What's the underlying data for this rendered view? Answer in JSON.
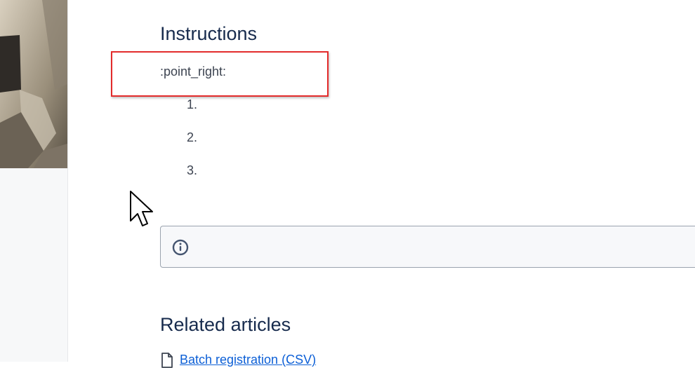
{
  "instructions": {
    "heading": "Instructions",
    "emoji_shortcode": ":point_right:",
    "steps": [
      "1.",
      "2.",
      "3."
    ]
  },
  "info_panel": {
    "icon": "info-icon"
  },
  "related": {
    "heading": "Related articles",
    "links": [
      {
        "label": "Batch registration (CSV)",
        "icon": "document-icon"
      }
    ]
  },
  "colors": {
    "heading": "#172b4d",
    "link": "#0c5fd6",
    "highlight_border": "#e32b2b",
    "info_icon": "#44546f"
  }
}
